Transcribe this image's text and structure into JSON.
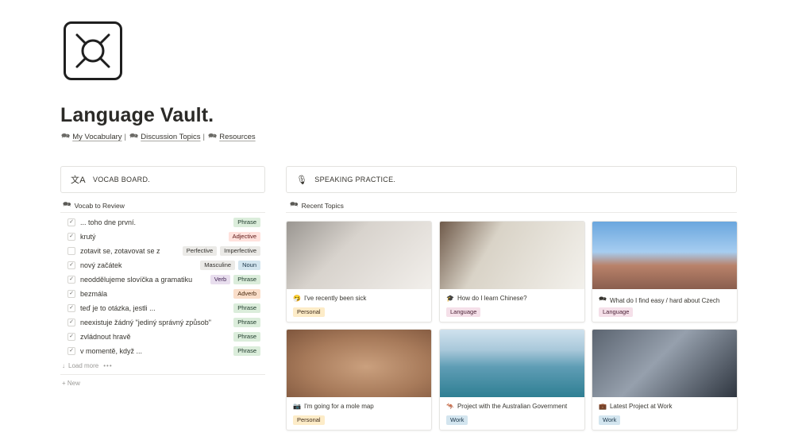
{
  "page": {
    "title": "Language Vault."
  },
  "links": [
    {
      "icon": "chat-bubbles-icon",
      "glyph": "🗪",
      "label": "My Vocabulary"
    },
    {
      "icon": "chat-bubbles-icon",
      "glyph": "🗪",
      "label": "Discussion Topics"
    },
    {
      "icon": "chat-bubbles-icon",
      "glyph": "🗪",
      "label": "Resources"
    }
  ],
  "link_separator": "|",
  "vocab_board": {
    "icon": "translate-icon",
    "glyph": "文A",
    "label": "VOCAB BOARD."
  },
  "speaking_practice": {
    "icon": "microphone-icon",
    "glyph": "🎙",
    "label": "SPEAKING PRACTICE."
  },
  "vocab_view": {
    "icon": "chat-bubbles-icon",
    "glyph": "🗪",
    "title": "Vocab to Review",
    "rows": [
      {
        "checked": true,
        "word": "... toho dne první.",
        "tags": [
          {
            "label": "Phrase",
            "color": "green"
          }
        ]
      },
      {
        "checked": true,
        "word": "krutý",
        "tags": [
          {
            "label": "Adjective",
            "color": "red"
          }
        ]
      },
      {
        "checked": false,
        "word": "zotavit se, zotavovat se z",
        "tags": [
          {
            "label": "Perfective",
            "color": "gray"
          },
          {
            "label": "Imperfective",
            "color": "gray"
          }
        ]
      },
      {
        "checked": true,
        "word": "nový začátek",
        "tags": [
          {
            "label": "Masculine",
            "color": "gray"
          },
          {
            "label": "Noun",
            "color": "blue"
          }
        ]
      },
      {
        "checked": true,
        "word": "neoddělujeme slovíčka a gramatiku",
        "tags": [
          {
            "label": "Verb",
            "color": "purple"
          },
          {
            "label": "Phrase",
            "color": "green"
          }
        ]
      },
      {
        "checked": true,
        "word": "bezmála",
        "tags": [
          {
            "label": "Adverb",
            "color": "orange"
          }
        ]
      },
      {
        "checked": true,
        "word": "teď je to otázka, jestli ...",
        "tags": [
          {
            "label": "Phrase",
            "color": "green"
          }
        ]
      },
      {
        "checked": true,
        "word": "neexistuje žádný \"jediný správný způsob\"",
        "tags": [
          {
            "label": "Phrase",
            "color": "green"
          }
        ]
      },
      {
        "checked": true,
        "word": "zvládnout hravě",
        "tags": [
          {
            "label": "Phrase",
            "color": "green"
          }
        ]
      },
      {
        "checked": true,
        "word": "v momentě, když ...",
        "tags": [
          {
            "label": "Phrase",
            "color": "green"
          }
        ]
      }
    ],
    "load_more": "Load more",
    "load_more_icon": "arrow-down-icon",
    "more_dots": "•••",
    "new_label": "+ New"
  },
  "topics_view": {
    "icon": "chat-bubbles-icon",
    "glyph": "🗪",
    "title": "Recent Topics",
    "cards": [
      {
        "image": "man-with-tissue",
        "icon": "sick-face-icon",
        "glyph": "🤧",
        "title": "I've recently been sick",
        "tag": {
          "label": "Personal",
          "color": "yellow"
        }
      },
      {
        "image": "chinese-calligraphy",
        "icon": "graduation-cap-icon",
        "glyph": "🎓",
        "title": "How do I learn Chinese?",
        "tag": {
          "label": "Language",
          "color": "pink"
        }
      },
      {
        "image": "prague-street",
        "icon": "chat-bubbles-icon",
        "glyph": "🗪",
        "title": "What do I find easy / hard about Czech",
        "tag": {
          "label": "Language",
          "color": "pink"
        }
      },
      {
        "image": "freckled-face",
        "icon": "camera-icon",
        "glyph": "📷",
        "title": "I'm going for a mole map",
        "tag": {
          "label": "Personal",
          "color": "yellow"
        }
      },
      {
        "image": "sydney-harbour",
        "icon": "kangaroo-icon",
        "glyph": "🦘",
        "title": "Project with the Australian Government",
        "tag": {
          "label": "Work",
          "color": "blue"
        }
      },
      {
        "image": "laptop-meeting",
        "icon": "briefcase-icon",
        "glyph": "💼",
        "title": "Latest Project at Work",
        "tag": {
          "label": "Work",
          "color": "blue"
        }
      }
    ]
  }
}
